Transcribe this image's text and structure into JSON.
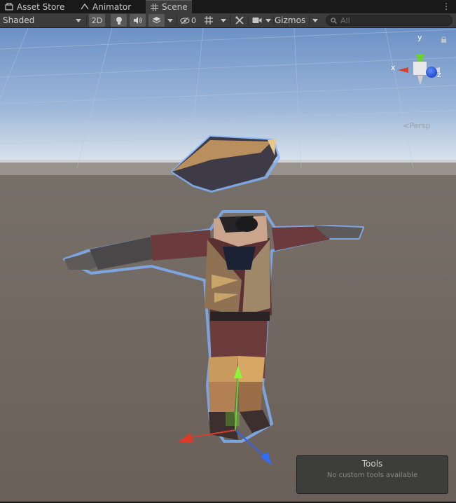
{
  "tabs": [
    {
      "label": "Asset Store",
      "icon": "asset-store-icon"
    },
    {
      "label": "Animator",
      "icon": "animator-icon"
    },
    {
      "label": "Scene",
      "icon": "scene-grid-icon",
      "active": true
    }
  ],
  "toolbar": {
    "draw_mode": "Shaded",
    "mode_2d": "2D",
    "hidden_count": "0",
    "gizmos": "Gizmos",
    "search_placeholder": "All"
  },
  "orientation_gizmo": {
    "x_label": "x",
    "y_label": "y",
    "z_label": "z",
    "projection": "Persp"
  },
  "tools_overlay": {
    "title": "Tools",
    "message": "No custom tools available"
  },
  "colors": {
    "x_axis": "#d4402c",
    "y_axis": "#6bd12d",
    "z_axis": "#2f64e6",
    "selection_outline": "#6fa8ff",
    "panel_bg": "#3c3c3c"
  }
}
